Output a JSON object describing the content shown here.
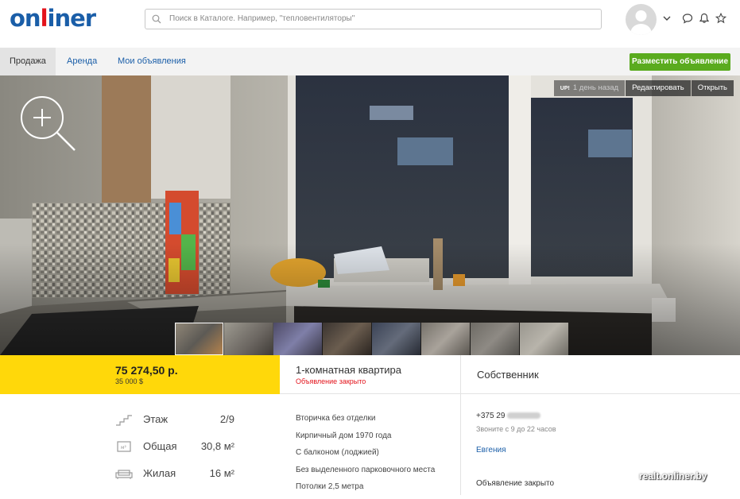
{
  "header": {
    "logo_part1": "on",
    "logo_part2": "l",
    "logo_part3": "iner",
    "search_placeholder": "Поиск в Каталоге. Например, \"тепловентиляторы\""
  },
  "nav": {
    "tabs": [
      "Продажа",
      "Аренда",
      "Мои объявления"
    ],
    "post_button": "Разместить объявление"
  },
  "photo": {
    "up_badge": "UP!",
    "posted_ago": "1 день назад",
    "edit_label": "Редактировать",
    "open_label": "Открыть"
  },
  "listing": {
    "price_byn": "75 274,50 р.",
    "price_usd": "35 000 $",
    "title": "1-комнатная квартира",
    "status": "Объявление закрыто",
    "seller_type": "Собственник"
  },
  "params": [
    {
      "label": "Этаж",
      "value": "2/9",
      "icon": "floor-icon"
    },
    {
      "label": "Общая",
      "value": "30,8 м²",
      "icon": "area-icon"
    },
    {
      "label": "Жилая",
      "value": "16 м²",
      "icon": "sofa-icon"
    }
  ],
  "features": [
    "Вторичка без отделки",
    "Кирпичный дом 1970 года",
    "С балконом (лоджией)",
    "Без выделенного парковочного места",
    "Потолки 2,5 метра"
  ],
  "contact": {
    "phone_prefix": "+375 29",
    "call_time": "Звоните с 9 до 22 часов",
    "name": "Евгения",
    "closed_note": "Объявление закрыто"
  },
  "watermark": "realt.onliner.by",
  "colors": {
    "brand_blue": "#1a5ea8",
    "brand_red": "#e3131b",
    "price_yellow": "#ffd80a",
    "post_green": "#5aab1e"
  }
}
